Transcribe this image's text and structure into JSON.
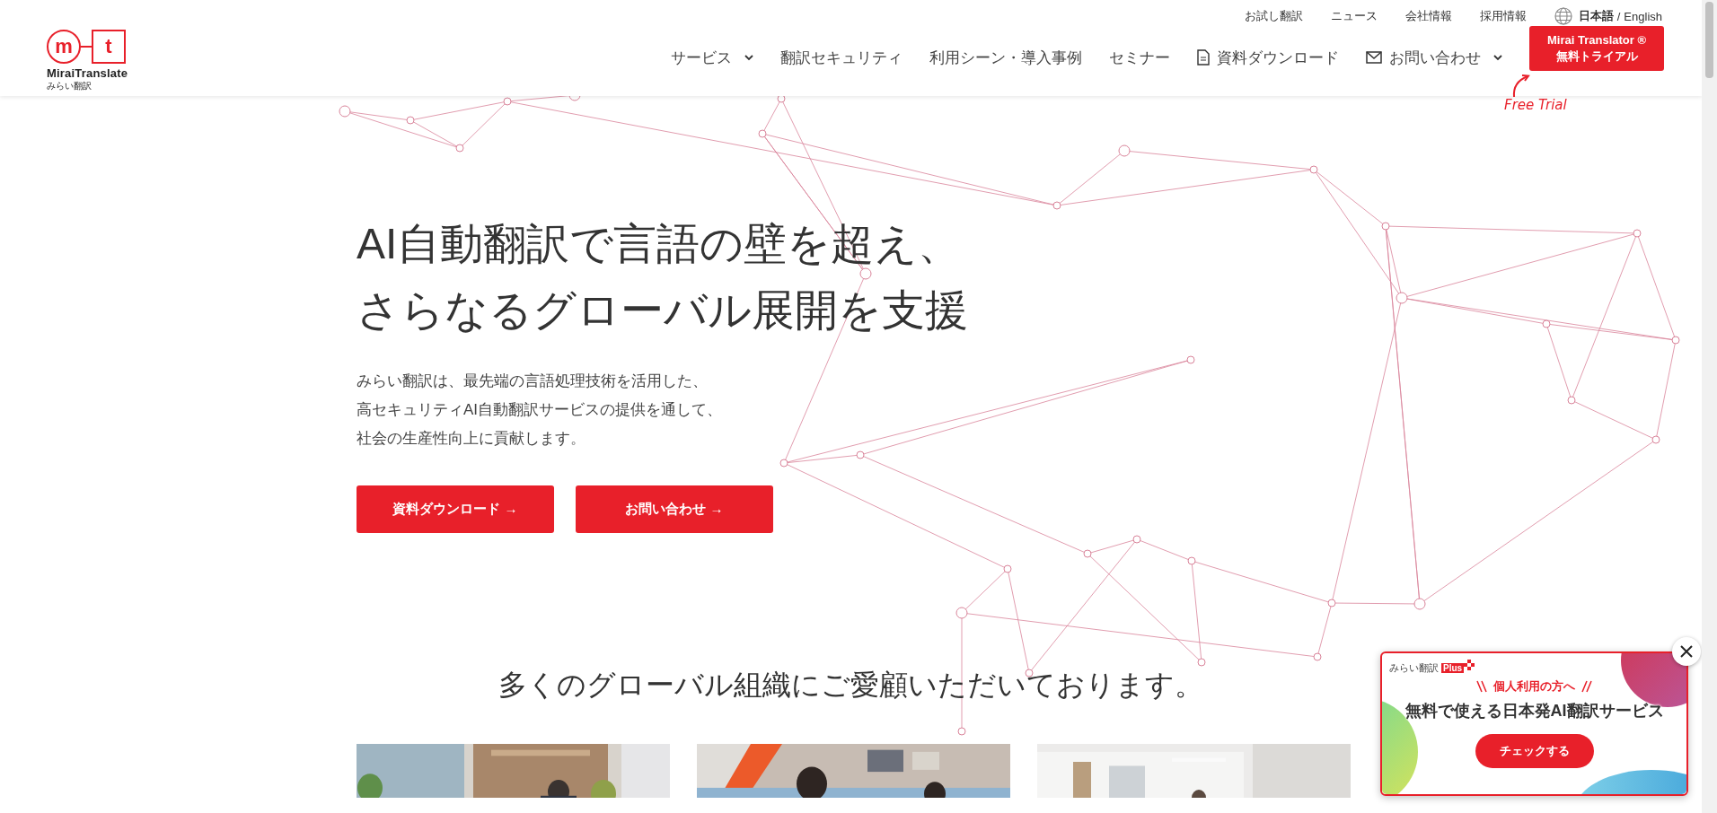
{
  "header": {
    "logo": {
      "letter_left": "m",
      "letter_right": "t",
      "wordmark": "MiraiTranslate",
      "subtitle": "みらい翻訳"
    },
    "top_links": [
      "お試し翻訳",
      "ニュース",
      "会社情報",
      "採用情報"
    ],
    "language": {
      "current": "日本語",
      "separator": "/",
      "other": "English"
    },
    "nav": [
      {
        "label": "サービス",
        "kind": "dropdown"
      },
      {
        "label": "翻訳セキュリティ",
        "kind": "plain"
      },
      {
        "label": "利用シーン・導入事例",
        "kind": "plain"
      },
      {
        "label": "セミナー",
        "kind": "plain"
      },
      {
        "label": "資料ダウンロード",
        "kind": "document"
      },
      {
        "label": "お問い合わせ",
        "kind": "mail-dropdown"
      }
    ],
    "cta": {
      "line1": "Mirai Translator ®",
      "line2": "無料トライアル",
      "note": "Free Trial"
    }
  },
  "hero": {
    "title": [
      "AI自動翻訳で言語の壁を超え、",
      "さらなるグローバル展開を支援"
    ],
    "description": [
      "みらい翻訳は、最先端の言語処理技術を活用した、",
      "高セキュリティAI自動翻訳サービスの提供を通して、",
      "社会の生産性向上に貢献します。"
    ],
    "buttons": [
      "資料ダウンロード →",
      "お問い合わせ →"
    ]
  },
  "clients": {
    "heading": "多くのグローバル組織にご愛顧いただいております。"
  },
  "popup": {
    "brand": "みらい翻訳",
    "badge": "Plus",
    "tagline": "個人利用の方へ",
    "headline": "無料で使える日本発AI翻訳サービス",
    "button": "チェックする"
  }
}
